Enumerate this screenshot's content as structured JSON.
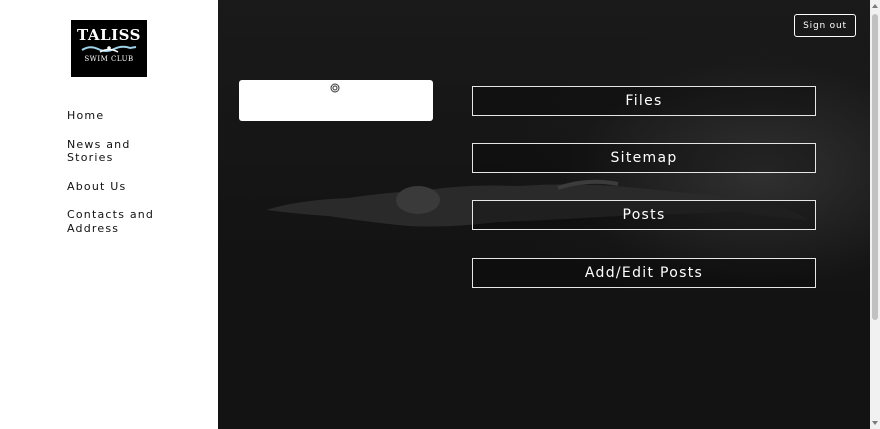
{
  "logo": {
    "line1": "TALISS",
    "line2": "SWIM CLUB"
  },
  "nav": {
    "items": [
      {
        "label": "Home"
      },
      {
        "label": "News and Stories"
      },
      {
        "label": "About Us"
      },
      {
        "label": "Contacts and Address"
      }
    ]
  },
  "header": {
    "signout_label": "Sign out"
  },
  "menu": {
    "files_label": "Files",
    "sitemap_label": "Sitemap",
    "posts_label": "Posts",
    "add_edit_posts_label": "Add/Edit Posts"
  },
  "icons": {
    "loading": "target-icon"
  },
  "colors": {
    "main_bg": "#131313",
    "sidebar_bg": "#ffffff",
    "button_border": "#e6e6e6"
  }
}
